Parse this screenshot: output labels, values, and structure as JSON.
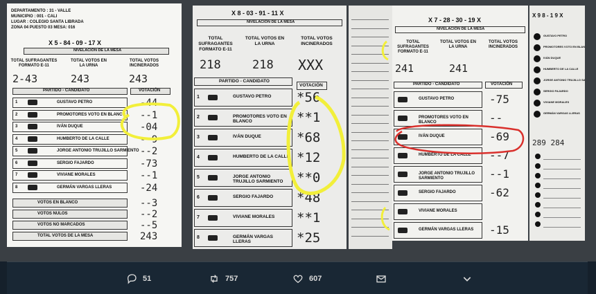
{
  "tweet_image": {
    "panel1": {
      "departamento": "DEPARTAMENTO : 31 - VALLE",
      "municipio": "MUNICIPIO : 001 - CALI",
      "lugar": "LUGAR : COLEGIO SANTA LIBRADA",
      "zona": "ZONA 04     PUESTO 03     MESA: 016",
      "mesa_code": "X  5 - 84 - 09 - 17  X",
      "nivelacion": "NIVELACIÓN DE LA MESA",
      "col1": "TOTAL SUFRAGANTES FORMATO E-11",
      "col2": "TOTAL VOTOS EN LA URNA",
      "col3": "TOTAL VOTOS INCINERADOS",
      "totals": [
        "2-43",
        "243",
        "243"
      ],
      "header_partido": "PARTIDO - CANDIDATO",
      "header_votacion": "VOTACIÓN",
      "rows": [
        {
          "num": "1",
          "name": "GUSTAVO PETRO",
          "votes": "-44"
        },
        {
          "num": "2",
          "name": "PROMOTORES VOTO EN BLANCO",
          "votes": "--1"
        },
        {
          "num": "3",
          "name": "IVÁN DUQUE",
          "votes": "-04"
        },
        {
          "num": "4",
          "name": "HUMBERTO DE LA CALLE",
          "votes": "--9"
        },
        {
          "num": "5",
          "name": "JORGE ANTONIO TRUJILLO SARMIENTO",
          "votes": "--2"
        },
        {
          "num": "6",
          "name": "SERGIO FAJARDO",
          "votes": "-73"
        },
        {
          "num": "7",
          "name": "VIVIANE MORALES",
          "votes": "--1"
        },
        {
          "num": "8",
          "name": "GERMÁN VARGAS LLERAS",
          "votes": "-24"
        }
      ],
      "footer_rows": [
        {
          "label": "VOTOS EN BLANCO",
          "votes": "--3"
        },
        {
          "label": "VOTOS NULOS",
          "votes": "--2"
        },
        {
          "label": "VOTOS NO MARCADOS",
          "votes": "--5"
        },
        {
          "label": "TOTAL VOTOS DE LA MESA",
          "votes": "243"
        }
      ]
    },
    "panel2": {
      "mesa_code": "X  8 - 03 - 91 - 11  X",
      "nivelacion": "NIVELACIÓN DE LA MESA",
      "col1": "TOTAL SUFRAGANTES FORMATO E-11",
      "col2": "TOTAL VOTOS EN LA URNA",
      "col3": "TOTAL VOTOS INCINERADOS",
      "totals": [
        "218",
        "218",
        "XXX"
      ],
      "header_partido": "PARTIDO - CANDIDATO",
      "header_votacion": "VOTACIÓN",
      "rows": [
        {
          "num": "1",
          "name": "GUSTAVO PETRO",
          "votes": "*56"
        },
        {
          "num": "2",
          "name": "PROMOTORES VOTO EN BLANCO",
          "votes": "**1"
        },
        {
          "num": "3",
          "name": "IVÁN DUQUE",
          "votes": "*68"
        },
        {
          "num": "4",
          "name": "HUMBERTO DE LA CALLE",
          "votes": "*12"
        },
        {
          "num": "5",
          "name": "JORGE ANTONIO TRUJILLO SARMIENTO",
          "votes": "**0"
        },
        {
          "num": "6",
          "name": "SERGIO FAJARDO",
          "votes": "*48"
        },
        {
          "num": "7",
          "name": "VIVIANE MORALES",
          "votes": "**1"
        },
        {
          "num": "8",
          "name": "GERMÁN VARGAS LLERAS",
          "votes": "*25"
        }
      ]
    },
    "panel4": {
      "mesa_code": "X  7 - 28 - 30 - 19  X",
      "nivelacion": "NIVELACIÓN DE LA MESA",
      "col1": "TOTAL SUFRAGANTES FORMATO E-11",
      "col2": "TOTAL VOTOS EN LA URNA",
      "col3": "TOTAL VOTOS INCINERADOS",
      "totals": [
        "241",
        "241",
        ""
      ],
      "header_partido": "PARTIDO - CANDIDATO",
      "header_votacion": "VOTACIÓN",
      "rows": [
        {
          "name": "GUSTAVO PETRO",
          "votes": "-75"
        },
        {
          "name": "PROMOTORES VOTO EN BLANCO",
          "votes": "--"
        },
        {
          "name": "IVÁN DUQUE",
          "votes": "-69"
        },
        {
          "name": "HUMBERTO DE LA CALLE",
          "votes": "--7"
        },
        {
          "name": "JORGE ANTONIO TRUJILLO SARMIENTO",
          "votes": "--1"
        },
        {
          "name": "SERGIO FAJARDO",
          "votes": "-62"
        },
        {
          "name": "VIVIANE MORALES",
          "votes": ""
        },
        {
          "name": "GERMÁN VARGAS LLERAS",
          "votes": "-15"
        }
      ]
    },
    "panel5": {
      "mesa_code": "X 9 8 - 1 9 X",
      "totals": "289   284",
      "items": [
        "GUSTAVO PETRO",
        "PROMOTORES VOTO EN BLANCO",
        "IVÁN DUQUE",
        "HUMBERTO DE LA CALLE",
        "JORGE ANTONIO TRUJILLO SARMIENTO",
        "SERGIO FAJARDO",
        "VIVIANE MORALES",
        "GERMÁN VARGAS LLERAS"
      ]
    }
  },
  "actions": {
    "reply_count": "51",
    "retweet_count": "757",
    "like_count": "607"
  },
  "colors": {
    "highlight_yellow": "#f2ef3a",
    "highlight_red": "#d9302c",
    "bar_bg": "#192734",
    "text": "#d9d9d9"
  }
}
